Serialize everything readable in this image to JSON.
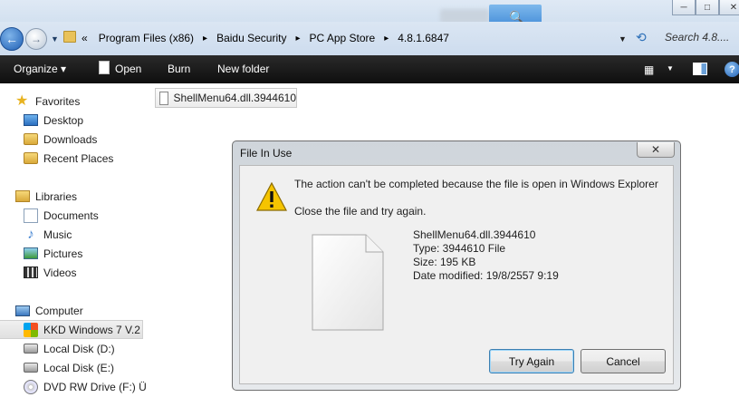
{
  "window": {
    "controls": {
      "minimize": "─",
      "maximize": "□",
      "close": "✕"
    }
  },
  "addressbar": {
    "overflow": "«",
    "breadcrumbs": [
      "Program Files (x86)",
      "Baidu Security",
      "PC App Store",
      "4.8.1.6847"
    ],
    "separator": "▸",
    "search_placeholder": "Search 4.8...."
  },
  "toolbar": {
    "organize_label": "Organize ▾",
    "open_label": "Open",
    "burn_label": "Burn",
    "new_folder_label": "New folder"
  },
  "sidebar": {
    "favorites": {
      "header": "Favorites",
      "items": [
        "Desktop",
        "Downloads",
        "Recent Places"
      ]
    },
    "libraries": {
      "header": "Libraries",
      "items": [
        "Documents",
        "Music",
        "Pictures",
        "Videos"
      ]
    },
    "computer": {
      "header": "Computer",
      "items": [
        "KKD Windows 7 V.2",
        "Local Disk (D:)",
        "Local Disk (E:)",
        "DVD RW Drive (F:) Ü"
      ]
    }
  },
  "content": {
    "selected_file": "ShellMenu64.dll.3944610"
  },
  "dialog": {
    "title": "File In Use",
    "close_glyph": "✕",
    "message": "The action can't be completed because the file is open in Windows Explorer",
    "instruction": "Close the file and try again.",
    "file": {
      "name": "ShellMenu64.dll.3944610",
      "type": "Type: 3944610 File",
      "size": "Size: 195 KB",
      "modified": "Date modified: 19/8/2557 9:19"
    },
    "buttons": {
      "try_again": "Try Again",
      "cancel": "Cancel"
    }
  },
  "colors": {
    "command_bar": "#121212",
    "address_bar": "#d3e1f0",
    "dialog_frame": "#d8dde2",
    "dialog_body": "#f0f0f0",
    "button_focus_border": "#3c7fb1"
  },
  "icons": [
    "back-arrow-icon",
    "forward-arrow-icon",
    "folder-icon",
    "refresh-icon",
    "search-icon",
    "document-icon",
    "views-icon",
    "preview-pane-icon",
    "help-icon",
    "star-icon",
    "warning-icon",
    "computer-icon",
    "drive-icon",
    "dvd-icon"
  ]
}
